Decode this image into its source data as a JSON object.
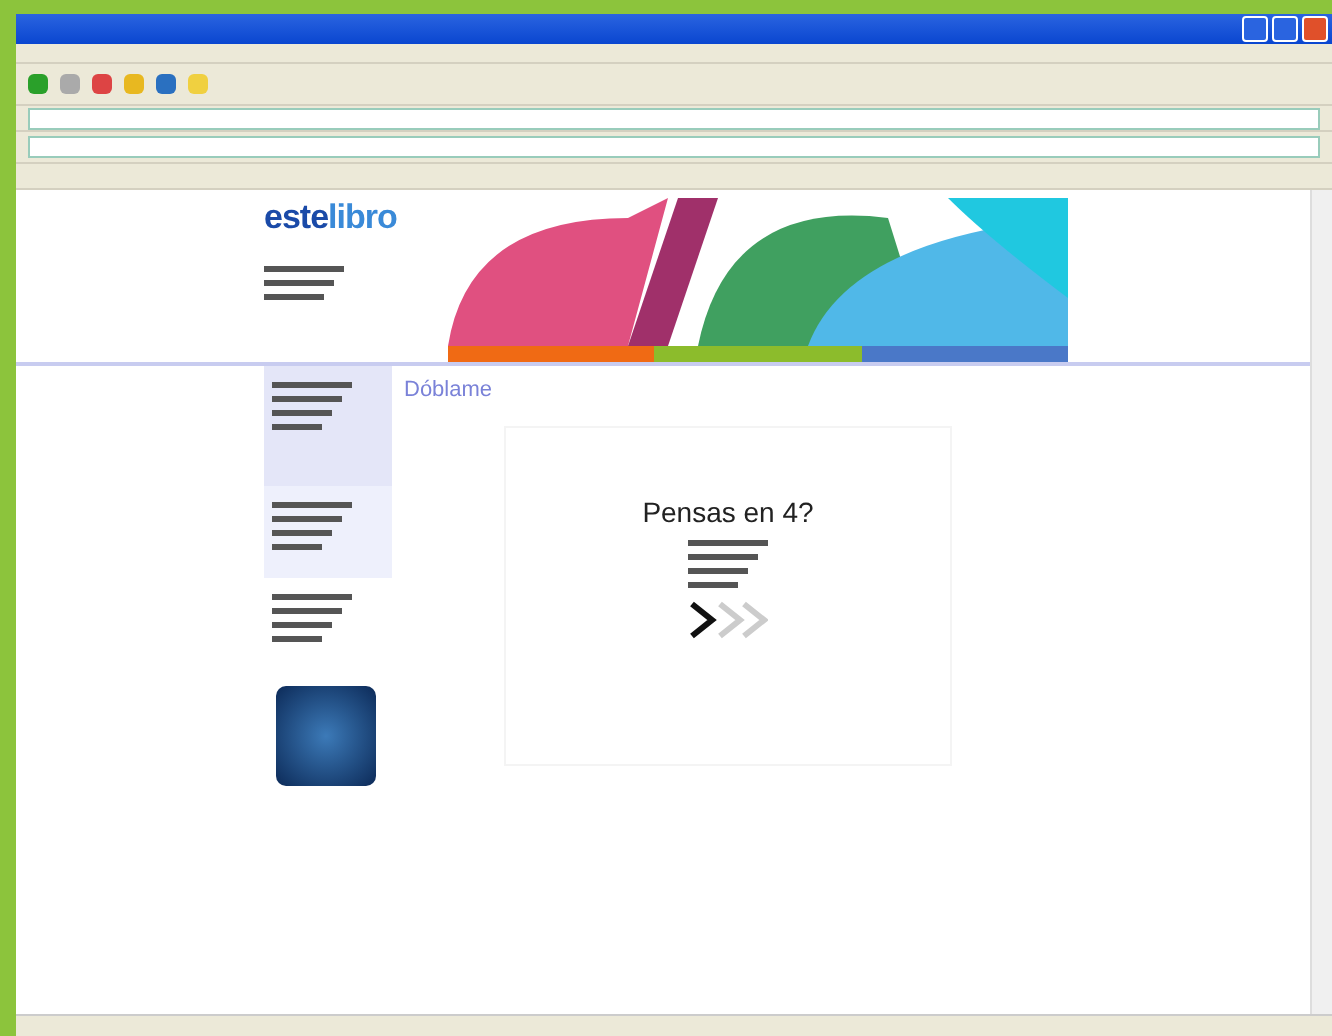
{
  "page": {
    "logo": {
      "text": "este",
      "bold": "libro"
    },
    "nav_strip": [
      {
        "color": "#f06a14"
      },
      {
        "color": "#8cbc2c"
      },
      {
        "color": "#4a78c8"
      }
    ],
    "breadcrumb": "Dóblame",
    "promo": {
      "heading": "Pensas en 4?"
    }
  }
}
